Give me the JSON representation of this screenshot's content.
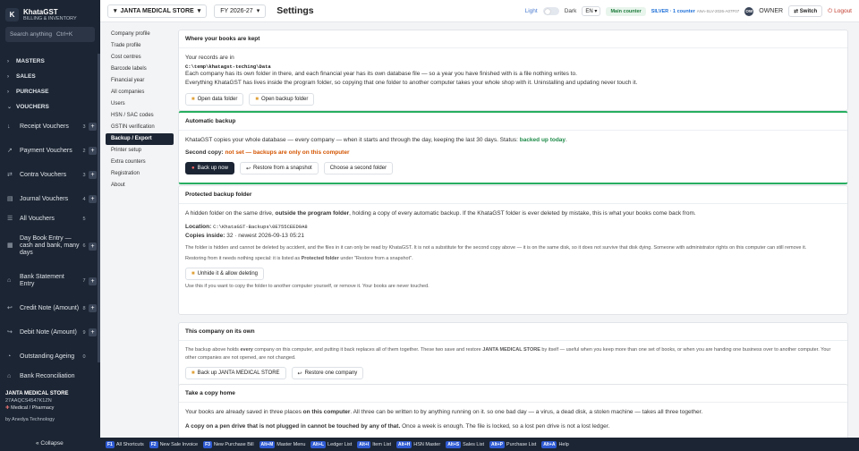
{
  "sidebar": {
    "brand_initial": "K",
    "brand_name": "KhataGST",
    "brand_sub": "BILLING & INVENTORY",
    "search_placeholder": "Search anything",
    "search_shortcut": "Ctrl+K",
    "sections": [
      {
        "label": "MASTERS",
        "expanded": false
      },
      {
        "label": "SALES",
        "expanded": false
      },
      {
        "label": "PURCHASE",
        "expanded": false
      },
      {
        "label": "VOUCHERS",
        "expanded": true
      }
    ],
    "vouchers": [
      {
        "icon": "receipt-icon",
        "label": "Receipt Vouchers",
        "count": "3"
      },
      {
        "icon": "payment-icon",
        "label": "Payment Vouchers",
        "count": "2"
      },
      {
        "icon": "contra-icon",
        "label": "Contra Vouchers",
        "count": "3"
      },
      {
        "icon": "journal-icon",
        "label": "Journal Vouchers",
        "count": "4"
      },
      {
        "icon": "list-icon",
        "label": "All Vouchers",
        "count": "5"
      },
      {
        "icon": "daybook-icon",
        "label": "Day Book Entry — cash and bank, many days",
        "count": "6"
      },
      {
        "icon": "bank-icon",
        "label": "Bank Statement Entry",
        "count": "7"
      },
      {
        "icon": "credit-note-icon",
        "label": "Credit Note (Amount)",
        "count": "8"
      },
      {
        "icon": "debit-note-icon",
        "label": "Debit Note (Amount)",
        "count": "9"
      },
      {
        "icon": "ageing-icon",
        "label": "Outstanding Ageing",
        "count": "0"
      },
      {
        "icon": "bank-recon-icon",
        "label": "Bank Reconciliation",
        "count": ""
      }
    ],
    "company_name": "JANTA MEDICAL STORE",
    "company_gstin": "27AAQCS4547K1ZN",
    "company_type": "Medical / Pharmacy",
    "footer": "by Anedya Technology",
    "collapse_label": "« Collapse"
  },
  "topbar": {
    "company": "JANTA MEDICAL STORE",
    "fy": "FY 2026-27",
    "title": "Settings",
    "light_label": "Light",
    "dark_label": "Dark",
    "lang": "EN",
    "counter": "Main counter",
    "license": "SILVER · 1 counter",
    "license_key": "ANA-SLV-2026-A07F07",
    "owner_initials": "OW",
    "owner": "OWNER",
    "switch": "Switch",
    "logout": "Logout"
  },
  "settings_menu": [
    {
      "label": "Company profile",
      "active": false
    },
    {
      "label": "Trade profile",
      "active": false
    },
    {
      "label": "Cost centres",
      "active": false
    },
    {
      "label": "Barcode labels",
      "active": false
    },
    {
      "label": "Financial year",
      "active": false
    },
    {
      "label": "All companies",
      "active": false
    },
    {
      "label": "Users",
      "active": false
    },
    {
      "label": "HSN / SAC codes",
      "active": false
    },
    {
      "label": "GSTIN verification",
      "active": false
    },
    {
      "label": "Backup / Export",
      "active": true
    },
    {
      "label": "Printer setup",
      "active": false
    },
    {
      "label": "Extra counters",
      "active": false
    },
    {
      "label": "Registration",
      "active": false
    },
    {
      "label": "About",
      "active": false
    }
  ],
  "where": {
    "title": "Where your books are kept",
    "line1": "Your records are in",
    "path": "C:\\temp\\khatagst-teching\\Data",
    "line2": "Each company has its own folder in there, and each financial year has its own database file — so a year you have finished with is a file nothing writes to.",
    "line3": "Everything KhataGST has lives inside the program folder, so copying that one folder to another computer takes your whole shop with it. Uninstalling and updating never touch it.",
    "btn_open_data": "Open data folder",
    "btn_open_backup": "Open backup folder"
  },
  "auto": {
    "title": "Automatic backup",
    "desc": "KhataGST copies your whole database — every company — when it starts and through the day, keeping the last 30 days. Status:",
    "status": "backed up today",
    "second_label": "Second copy:",
    "second_value": "not set — backups are only on this computer",
    "btn_backup": "Back up now",
    "btn_restore": "Restore from a snapshot",
    "btn_choose": "Choose a second folder"
  },
  "protected": {
    "title": "Protected backup folder",
    "desc_a": "A hidden folder on the same drive,",
    "desc_b": "outside the program folder",
    "desc_c": ", holding a copy of every automatic backup. If the KhataGST folder is ever deleted by mistake, this is what your books come back from.",
    "location_label": "Location:",
    "location_path": "C:\\KhataGST-Backups\\0E755CEED9A8",
    "copies_label": "Copies inside:",
    "copies_value": "32 · newest 2026-09-13 05:21",
    "note1": "The folder is hidden and cannot be deleted by accident, and the files in it can only be read by KhataGST. It is not a substitute for the second copy above — it is on the same disk, so it does not survive that disk dying. Someone with administrator rights on this computer can still remove it.",
    "note2_a": "Restoring from it needs nothing special: it is listed as",
    "note2_b": "Protected folder",
    "note2_c": "under \"Restore from a snapshot\".",
    "btn_unhide": "Unhide it & allow deleting",
    "note3": "Use this if you want to copy the folder to another computer yourself, or remove it. Your books are never touched."
  },
  "thisco": {
    "title": "This company on its own",
    "desc_a": "The backup above holds",
    "desc_b": "every",
    "desc_c": "company on this computer, and putting it back replaces all of them together. These two save and restore",
    "desc_d": "JANTA MEDICAL STORE",
    "desc_e": "by itself — useful when you keep more than one set of books, or when you are handing one business over to another computer. Your other companies are not opened, are not changed.",
    "btn_backup": "Back up JANTA MEDICAL STORE",
    "btn_restore": "Restore one company"
  },
  "takehome": {
    "title": "Take a copy home",
    "desc_a": "Your books are already saved in three places",
    "desc_b": "on this computer",
    "desc_c": ". All three can be written to by anything running on it. so one bad day — a virus, a dead disk, a stolen machine — takes all three together.",
    "line2_a": "A copy on a pen drive that is not plugged in cannot be touched by any of that.",
    "line2_b": "Once a week is enough. The file is locked, so a lost pen drive is not a lost ledger."
  },
  "shortcuts": [
    {
      "key": "F1",
      "label": "All Shortcuts"
    },
    {
      "key": "F2",
      "label": "New Sale Invoice"
    },
    {
      "key": "F3",
      "label": "New Purchase Bill"
    },
    {
      "key": "Alt+M",
      "label": "Master Menu"
    },
    {
      "key": "Alt+L",
      "label": "Ledger List"
    },
    {
      "key": "Alt+I",
      "label": "Item List"
    },
    {
      "key": "Alt+H",
      "label": "HSN Master"
    },
    {
      "key": "Alt+S",
      "label": "Sales List"
    },
    {
      "key": "Alt+P",
      "label": "Purchase List"
    },
    {
      "key": "Alt+A",
      "label": "Help"
    }
  ],
  "colors": {
    "sidebar_bg": "#1c2533",
    "accent_green": "#27ae60",
    "warn_orange": "#d35400",
    "key_blue": "#2f5bd3"
  }
}
